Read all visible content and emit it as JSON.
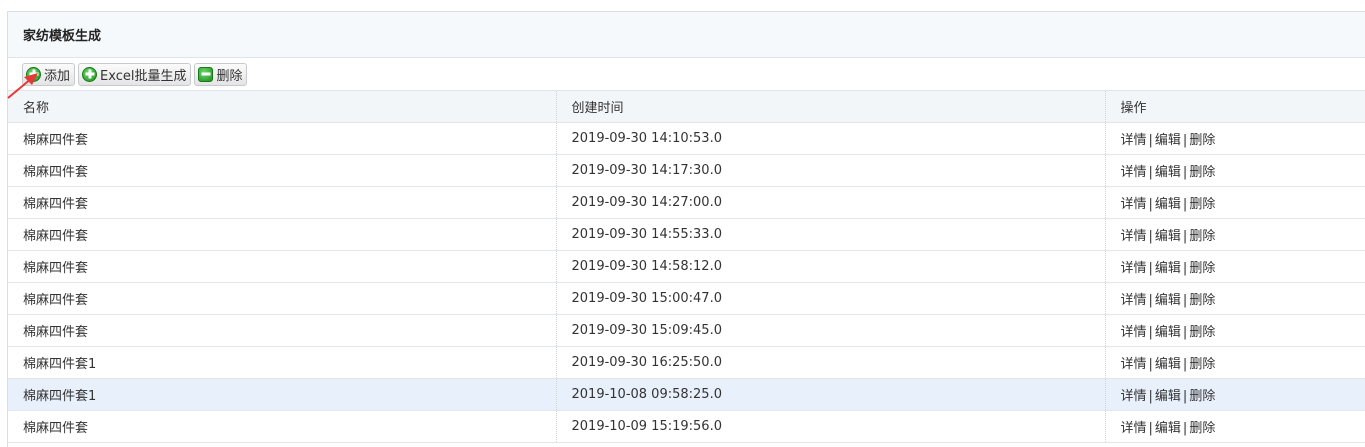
{
  "panel": {
    "title": "家纺模板生成"
  },
  "toolbar": {
    "add_label": "添加",
    "excel_label": "Excel批量生成",
    "delete_label": "删除"
  },
  "table": {
    "headers": [
      "名称",
      "创建时间",
      "操作"
    ],
    "actions": {
      "detail": "详情",
      "edit": "编辑",
      "delete": "删除",
      "separator": "|"
    },
    "rows": [
      {
        "name": "棉麻四件套",
        "created": "2019-09-30 14:10:53.0"
      },
      {
        "name": "棉麻四件套",
        "created": "2019-09-30 14:17:30.0"
      },
      {
        "name": "棉麻四件套",
        "created": "2019-09-30 14:27:00.0"
      },
      {
        "name": "棉麻四件套",
        "created": "2019-09-30 14:55:33.0"
      },
      {
        "name": "棉麻四件套",
        "created": "2019-09-30 14:58:12.0"
      },
      {
        "name": "棉麻四件套",
        "created": "2019-09-30 15:00:47.0"
      },
      {
        "name": "棉麻四件套",
        "created": "2019-09-30 15:09:45.0"
      },
      {
        "name": "棉麻四件套1",
        "created": "2019-09-30 16:25:50.0"
      },
      {
        "name": "棉麻四件套1",
        "created": "2019-10-08 09:58:25.0"
      },
      {
        "name": "棉麻四件套",
        "created": "2019-10-09 15:19:56.0"
      }
    ],
    "highlighted_row": 8
  },
  "colors": {
    "accent_green": "#1e8f1e",
    "highlight_row": "#e8f0fc",
    "arrow": "#e53935"
  },
  "icons": {
    "add": "plus-circle-icon",
    "excel": "plus-circle-icon",
    "delete": "minus-icon",
    "pointer": "red-arrow-icon"
  }
}
